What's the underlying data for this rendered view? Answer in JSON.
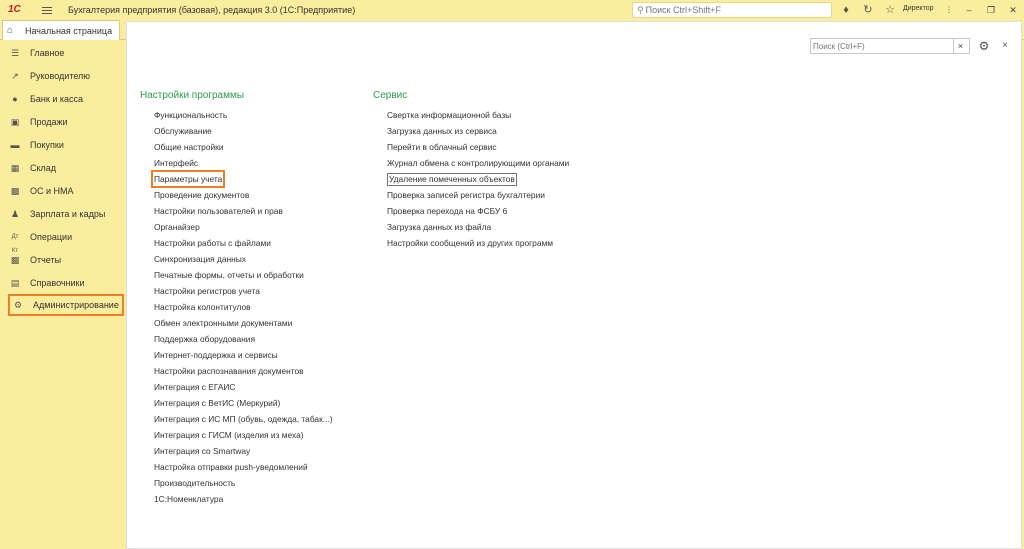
{
  "app": {
    "logo_text": "1С",
    "title": "Бухгалтерия предприятия (базовая), редакция 3.0  (1С:Предприятие)",
    "search_placeholder": "Поиск Ctrl+Shift+F",
    "user": "Директор"
  },
  "tabs": {
    "home": "Начальная страница"
  },
  "sidebar": {
    "items": [
      {
        "label": "Главное",
        "icon": "menu-lines-icon"
      },
      {
        "label": "Руководителю",
        "icon": "trend-up-icon"
      },
      {
        "label": "Банк и касса",
        "icon": "coins-icon"
      },
      {
        "label": "Продажи",
        "icon": "shopping-bag-icon"
      },
      {
        "label": "Покупки",
        "icon": "cart-icon"
      },
      {
        "label": "Склад",
        "icon": "warehouse-icon"
      },
      {
        "label": "ОС и НМА",
        "icon": "truck-icon"
      },
      {
        "label": "Зарплата и кадры",
        "icon": "person-icon"
      },
      {
        "label": "Операции",
        "icon": "debit-credit-icon"
      },
      {
        "label": "Отчеты",
        "icon": "bar-chart-icon"
      },
      {
        "label": "Справочники",
        "icon": "books-icon"
      },
      {
        "label": "Администрирование",
        "icon": "gear-icon"
      }
    ]
  },
  "panel": {
    "search_placeholder": "Поиск (Ctrl+F)",
    "clear_label": "×",
    "close_label": "×"
  },
  "settings": {
    "title": "Настройки программы",
    "links": [
      "Функциональность",
      "Обслуживание",
      "Общие настройки",
      "Интерфейс",
      "Параметры учета",
      "Проведение документов",
      "Настройки пользователей и прав",
      "Органайзер",
      "Настройки работы с файлами",
      "Синхронизация данных",
      "Печатные формы, отчеты и обработки",
      "Настройки регистров учета",
      "Настройка колонтитулов",
      "Обмен электронными документами",
      "Поддержка оборудования",
      "Интернет-поддержка и сервисы",
      "Настройки распознавания документов",
      "Интеграция с ЕГАИС",
      "Интеграция с ВетИС (Меркурий)",
      "Интеграция с ИС МП (обувь, одежда, табак...)",
      "Интеграция с ГИСМ (изделия из меха)",
      "Интеграция со Smartway",
      "Настройка отправки push-уведомлений",
      "Производительность",
      "1С:Номенклатура"
    ]
  },
  "service": {
    "title": "Сервис",
    "links": [
      "Свертка информационной базы",
      "Загрузка данных из сервиса",
      "Перейти в облачный сервис",
      "Журнал обмена с контролирующими органами",
      "Удаление помеченных объектов",
      "Проверка записей регистра бухгалтерии",
      "Проверка перехода на ФСБУ 6",
      "Загрузка данных из файла",
      "Настройки сообщений из других программ"
    ]
  },
  "colors": {
    "chrome": "#fbed9e",
    "group_title": "#2f9a4a",
    "highlight": "#f07f24",
    "logo": "#d2161f"
  }
}
